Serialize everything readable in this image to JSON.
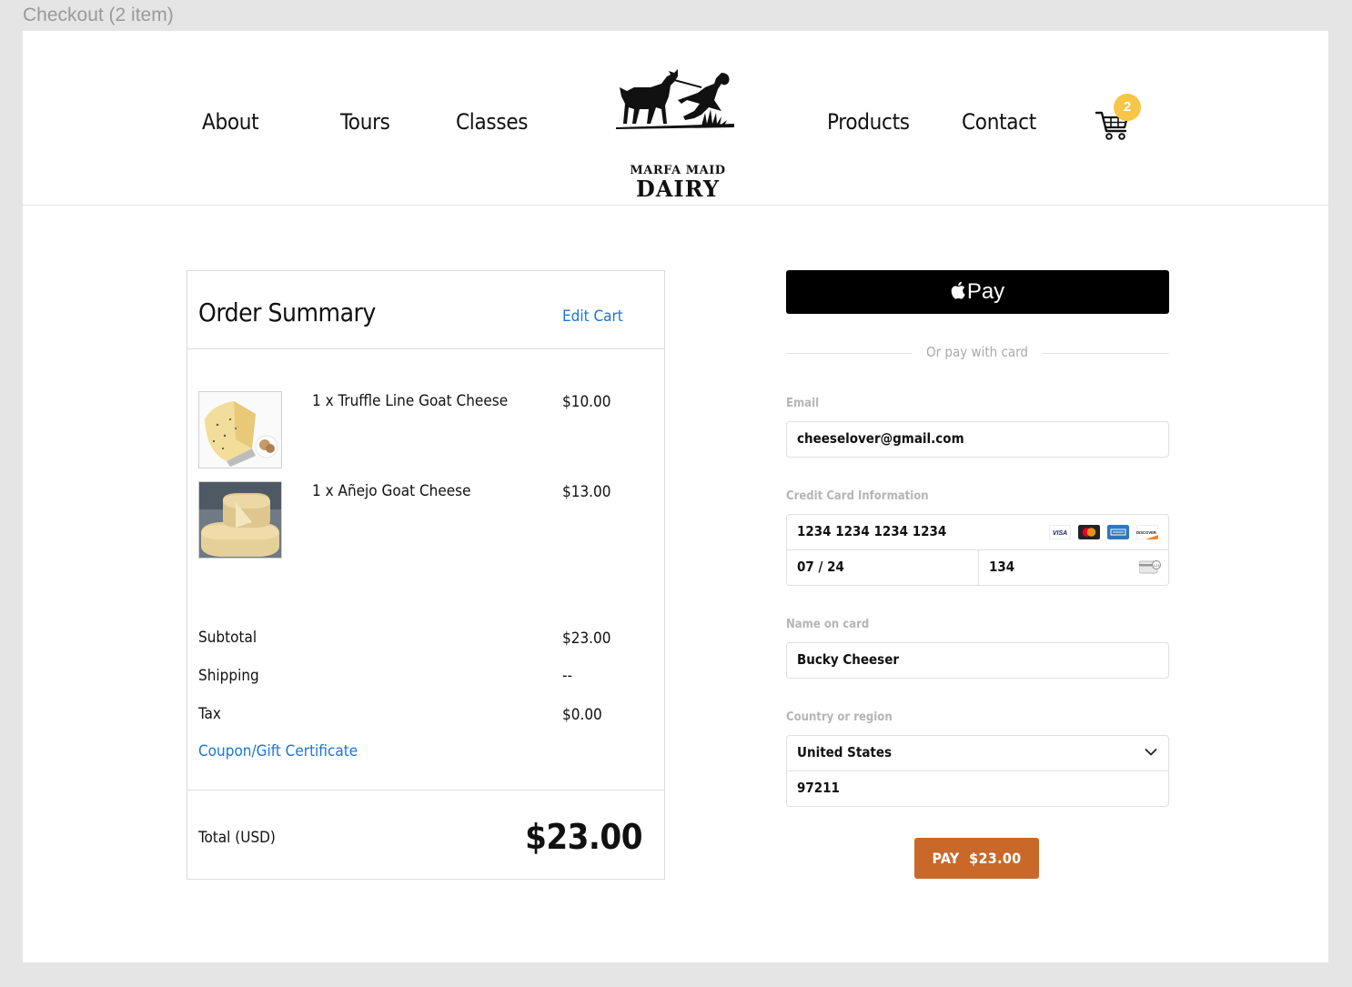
{
  "frame": {
    "title": "Checkout (2 item)"
  },
  "nav": {
    "about": "About",
    "tours": "Tours",
    "classes": "Classes",
    "products": "Products",
    "contact": "Contact"
  },
  "logo": {
    "line1": "MARFA MAID",
    "line2": "DAIRY"
  },
  "cart": {
    "count": "2",
    "icon": "cart-icon"
  },
  "summary": {
    "title": "Order Summary",
    "edit_cart": "Edit Cart",
    "items": [
      {
        "name": "1 x Truffle Line Goat Cheese",
        "price": "$10.00"
      },
      {
        "name": "1 x Añejo Goat Cheese",
        "price": "$13.00"
      }
    ],
    "subtotal_label": "Subtotal",
    "subtotal_value": "$23.00",
    "shipping_label": "Shipping",
    "shipping_value": "--",
    "tax_label": "Tax",
    "tax_value": "$0.00",
    "coupon": "Coupon/Gift Certificate",
    "total_label": "Total (USD)",
    "total_value": "$23.00"
  },
  "payment": {
    "apple_pay": "Pay",
    "or_text": "Or pay with card",
    "email_label": "Email",
    "email_value": "cheeselover@gmail.com",
    "card_label": "Credit Card Information",
    "card_number": "1234 1234 1234 1234",
    "card_expiry": "07 / 24",
    "card_cvc": "134",
    "card_brands": [
      "VISA",
      "Mastercard",
      "American Express",
      "DISCOVER"
    ],
    "name_label": "Name on card",
    "name_value": "Bucky Cheeser",
    "country_label": "Country or region",
    "country_value": "United States",
    "zip_value": "97211",
    "pay_button": "PAY  $23.00"
  },
  "colors": {
    "link": "#1976d2",
    "badge": "#f7c548",
    "pay_button": "#c8692a",
    "apple_pay_bg": "#000000"
  }
}
